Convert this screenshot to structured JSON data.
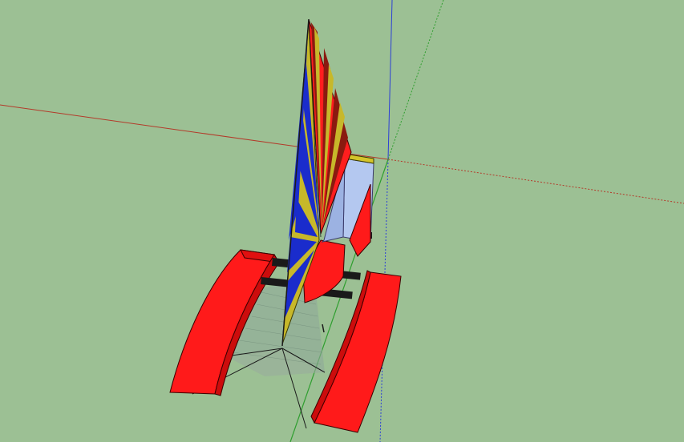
{
  "viewport": {
    "background": "#9cc094",
    "axes": {
      "red_axis": {
        "color": "#b33a2a",
        "label": "red-axis"
      },
      "green_axis": {
        "color": "#2f9e2f",
        "label": "green-axis"
      },
      "blue_axis": {
        "color": "#2c3fd6",
        "label": "blue-axis"
      }
    },
    "model": {
      "hull_color": "#ff1a1a",
      "hull_edge_color": "#3a0000",
      "sail_colors": [
        "#c7b82a",
        "#1a2ccc",
        "#8a1a10",
        "#ff1e1e"
      ],
      "cabin_color": "#b4c8f0",
      "crossbar_color": "#1a1a1a",
      "net_color": "#8fa89a"
    }
  }
}
